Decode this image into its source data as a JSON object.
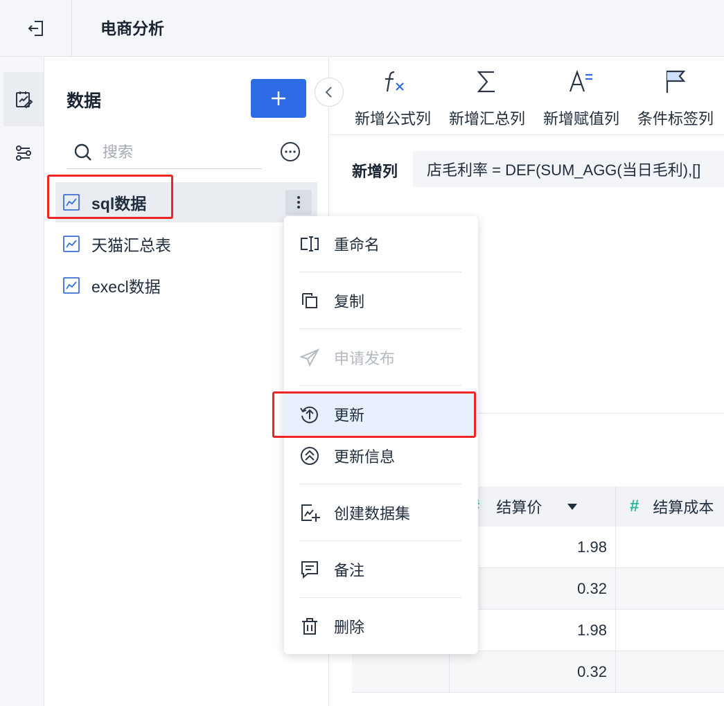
{
  "topbar": {
    "title": "电商分析"
  },
  "panel": {
    "title": "数据",
    "search_placeholder": "搜索",
    "datasets": [
      {
        "label": "sql数据"
      },
      {
        "label": "天猫汇总表"
      },
      {
        "label": "execl数据"
      }
    ]
  },
  "toolbar": {
    "tools": [
      {
        "label": "新增公式列"
      },
      {
        "label": "新增汇总列"
      },
      {
        "label": "新增赋值列"
      },
      {
        "label": "条件标签列"
      }
    ]
  },
  "formula": {
    "label": "新增列",
    "value": "店毛利率 = DEF(SUM_AGG(当日毛利),[]"
  },
  "grid": {
    "columns": [
      {
        "name": "结算价"
      },
      {
        "name": "结算成本"
      }
    ],
    "rows": [
      "1.98",
      "0.32",
      "1.98",
      "0.32"
    ]
  },
  "menu": {
    "items": [
      {
        "label": "重命名"
      },
      {
        "label": "复制"
      },
      {
        "label": "申请发布"
      },
      {
        "label": "更新"
      },
      {
        "label": "更新信息"
      },
      {
        "label": "创建数据集"
      },
      {
        "label": "备注"
      },
      {
        "label": "删除"
      }
    ]
  },
  "colors": {
    "accent": "#2d6be4",
    "highlight": "#ef2525",
    "number_icon": "#2bb59a"
  }
}
